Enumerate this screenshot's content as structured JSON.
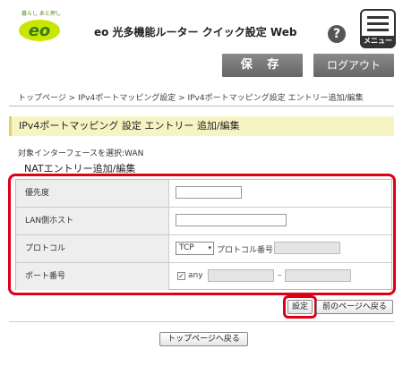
{
  "header": {
    "brand_tagline": "暮らし あと押し",
    "brand_logo": "eo",
    "app_title": "eo 光多機能ルーター クイック設定 Web",
    "help_icon": "?",
    "menu_label": "メニュー"
  },
  "toolbar": {
    "save_label": "保 存",
    "logout_label": "ログアウト"
  },
  "breadcrumb": "トップページ > IPv4ポートマッピング設定 > IPv4ポートマッピング設定 エントリー追加/編集",
  "page_title": "IPv4ポートマッピング 設定 エントリー 追加/編集",
  "interface_label": "対象インターフェースを選択:WAN",
  "section_title": "NATエントリー追加/編集",
  "form": {
    "priority": {
      "label": "優先度",
      "value": ""
    },
    "lan_host": {
      "label": "LAN側ホスト",
      "value": ""
    },
    "protocol": {
      "label": "プロトコル",
      "selected": "TCP",
      "number_label": "プロトコル番号",
      "number_value": ""
    },
    "port": {
      "label": "ポート番号",
      "any_label": "any",
      "any_checked": true,
      "separator": "–",
      "from": "",
      "to": ""
    }
  },
  "buttons": {
    "set_label": "設定",
    "back_label": "前のページへ戻る",
    "top_label": "トップページへ戻る"
  },
  "colors": {
    "highlight": "#e00016",
    "title_bg": "#f7f4c4",
    "brand_green": "#6cbf2a"
  }
}
